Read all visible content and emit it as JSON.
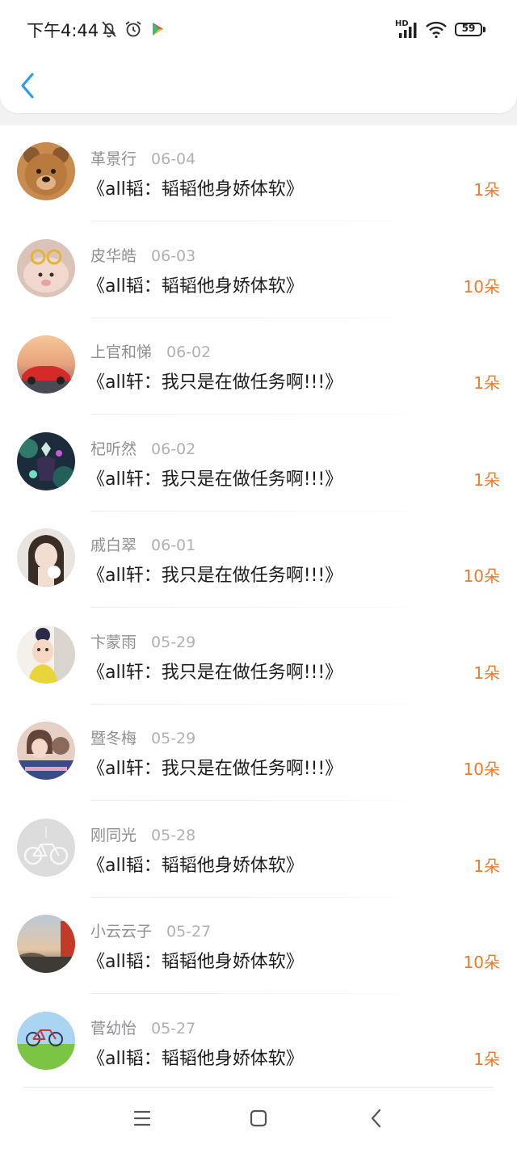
{
  "status_bar": {
    "time": "下午4:44",
    "battery": "59",
    "network": "HD"
  },
  "colors": {
    "accent": "#2f9ee8",
    "amount": "#f07a2c"
  },
  "header": {
    "back_icon": "chevron-left-icon"
  },
  "records": [
    {
      "name": "革景行",
      "date": "06-04",
      "title": "《all韬：韬韬他身娇体软》",
      "amount": "1朵"
    },
    {
      "name": "皮华皓",
      "date": "06-03",
      "title": "《all韬：韬韬他身娇体软》",
      "amount": "10朵"
    },
    {
      "name": "上官和悌",
      "date": "06-02",
      "title": "《all轩：我只是在做任务啊!!!》",
      "amount": "1朵"
    },
    {
      "name": "杞听然",
      "date": "06-02",
      "title": "《all轩：我只是在做任务啊!!!》",
      "amount": "1朵"
    },
    {
      "name": "戚白翠",
      "date": "06-01",
      "title": "《all轩：我只是在做任务啊!!!》",
      "amount": "10朵"
    },
    {
      "name": "卞蒙雨",
      "date": "05-29",
      "title": "《all轩：我只是在做任务啊!!!》",
      "amount": "1朵"
    },
    {
      "name": "暨冬梅",
      "date": "05-29",
      "title": "《all轩：我只是在做任务啊!!!》",
      "amount": "10朵"
    },
    {
      "name": "刚同光",
      "date": "05-28",
      "title": "《all韬：韬韬他身娇体软》",
      "amount": "1朵"
    },
    {
      "name": "小云云子",
      "date": "05-27",
      "title": "《all韬：韬韬他身娇体软》",
      "amount": "10朵"
    },
    {
      "name": "菅幼怡",
      "date": "05-27",
      "title": "《all韬：韬韬他身娇体软》",
      "amount": "1朵"
    }
  ],
  "nav_bar": {
    "menu_icon": "menu-icon",
    "home_icon": "home-square-icon",
    "back_icon": "back-triangle-icon"
  }
}
